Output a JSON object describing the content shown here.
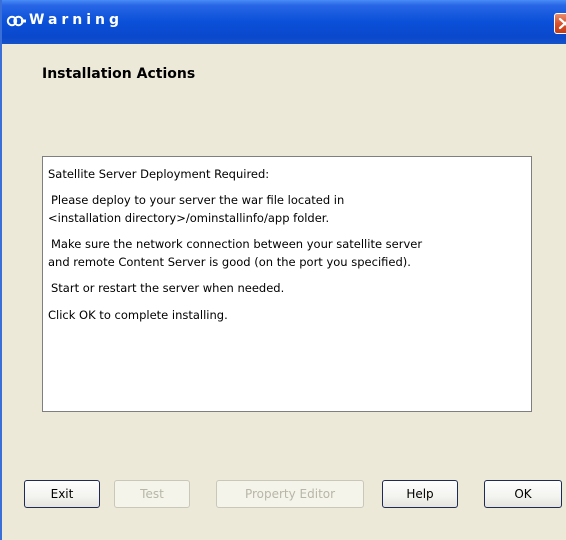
{
  "window": {
    "title": "Warning",
    "close_icon": "close-icon",
    "logo_icon": "infinity-logo-icon"
  },
  "page": {
    "heading": "Installation Actions"
  },
  "message": {
    "lines": [
      "Satellite Server Deployment Required:",
      "",
      "Please deploy to your server the war file located in",
      "<installation directory>/ominstallinfo/app folder.",
      "",
      "Make sure the network connection between your satellite server",
      "and remote Content Server is good (on the port you specified).",
      "",
      "Start or restart the server when needed.",
      "",
      "Click OK to complete installing."
    ]
  },
  "buttons": {
    "exit": "Exit",
    "test": "Test",
    "property_editor": "Property Editor",
    "help": "Help",
    "ok": "OK"
  },
  "colors": {
    "titlebar": "#0a50d8",
    "close": "#d8522f",
    "window_bg": "#ece9d8"
  }
}
